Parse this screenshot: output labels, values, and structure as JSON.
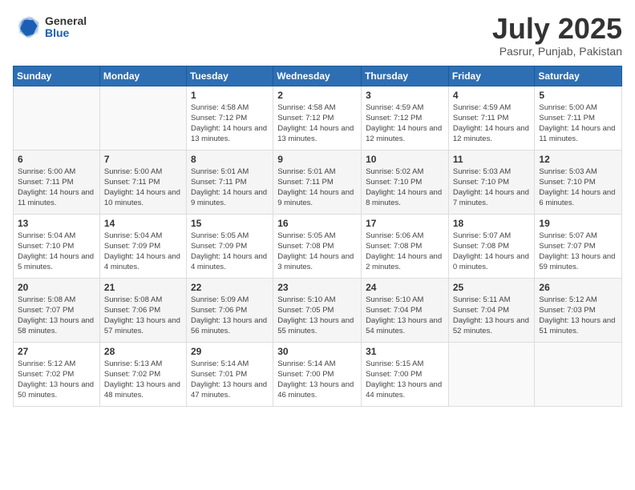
{
  "header": {
    "logo_general": "General",
    "logo_blue": "Blue",
    "month_title": "July 2025",
    "location": "Pasrur, Punjab, Pakistan"
  },
  "weekdays": [
    "Sunday",
    "Monday",
    "Tuesday",
    "Wednesday",
    "Thursday",
    "Friday",
    "Saturday"
  ],
  "weeks": [
    [
      {
        "day": "",
        "sunrise": "",
        "sunset": "",
        "daylight": ""
      },
      {
        "day": "",
        "sunrise": "",
        "sunset": "",
        "daylight": ""
      },
      {
        "day": "1",
        "sunrise": "Sunrise: 4:58 AM",
        "sunset": "Sunset: 7:12 PM",
        "daylight": "Daylight: 14 hours and 13 minutes."
      },
      {
        "day": "2",
        "sunrise": "Sunrise: 4:58 AM",
        "sunset": "Sunset: 7:12 PM",
        "daylight": "Daylight: 14 hours and 13 minutes."
      },
      {
        "day": "3",
        "sunrise": "Sunrise: 4:59 AM",
        "sunset": "Sunset: 7:12 PM",
        "daylight": "Daylight: 14 hours and 12 minutes."
      },
      {
        "day": "4",
        "sunrise": "Sunrise: 4:59 AM",
        "sunset": "Sunset: 7:11 PM",
        "daylight": "Daylight: 14 hours and 12 minutes."
      },
      {
        "day": "5",
        "sunrise": "Sunrise: 5:00 AM",
        "sunset": "Sunset: 7:11 PM",
        "daylight": "Daylight: 14 hours and 11 minutes."
      }
    ],
    [
      {
        "day": "6",
        "sunrise": "Sunrise: 5:00 AM",
        "sunset": "Sunset: 7:11 PM",
        "daylight": "Daylight: 14 hours and 11 minutes."
      },
      {
        "day": "7",
        "sunrise": "Sunrise: 5:00 AM",
        "sunset": "Sunset: 7:11 PM",
        "daylight": "Daylight: 14 hours and 10 minutes."
      },
      {
        "day": "8",
        "sunrise": "Sunrise: 5:01 AM",
        "sunset": "Sunset: 7:11 PM",
        "daylight": "Daylight: 14 hours and 9 minutes."
      },
      {
        "day": "9",
        "sunrise": "Sunrise: 5:01 AM",
        "sunset": "Sunset: 7:11 PM",
        "daylight": "Daylight: 14 hours and 9 minutes."
      },
      {
        "day": "10",
        "sunrise": "Sunrise: 5:02 AM",
        "sunset": "Sunset: 7:10 PM",
        "daylight": "Daylight: 14 hours and 8 minutes."
      },
      {
        "day": "11",
        "sunrise": "Sunrise: 5:03 AM",
        "sunset": "Sunset: 7:10 PM",
        "daylight": "Daylight: 14 hours and 7 minutes."
      },
      {
        "day": "12",
        "sunrise": "Sunrise: 5:03 AM",
        "sunset": "Sunset: 7:10 PM",
        "daylight": "Daylight: 14 hours and 6 minutes."
      }
    ],
    [
      {
        "day": "13",
        "sunrise": "Sunrise: 5:04 AM",
        "sunset": "Sunset: 7:10 PM",
        "daylight": "Daylight: 14 hours and 5 minutes."
      },
      {
        "day": "14",
        "sunrise": "Sunrise: 5:04 AM",
        "sunset": "Sunset: 7:09 PM",
        "daylight": "Daylight: 14 hours and 4 minutes."
      },
      {
        "day": "15",
        "sunrise": "Sunrise: 5:05 AM",
        "sunset": "Sunset: 7:09 PM",
        "daylight": "Daylight: 14 hours and 4 minutes."
      },
      {
        "day": "16",
        "sunrise": "Sunrise: 5:05 AM",
        "sunset": "Sunset: 7:08 PM",
        "daylight": "Daylight: 14 hours and 3 minutes."
      },
      {
        "day": "17",
        "sunrise": "Sunrise: 5:06 AM",
        "sunset": "Sunset: 7:08 PM",
        "daylight": "Daylight: 14 hours and 2 minutes."
      },
      {
        "day": "18",
        "sunrise": "Sunrise: 5:07 AM",
        "sunset": "Sunset: 7:08 PM",
        "daylight": "Daylight: 14 hours and 0 minutes."
      },
      {
        "day": "19",
        "sunrise": "Sunrise: 5:07 AM",
        "sunset": "Sunset: 7:07 PM",
        "daylight": "Daylight: 13 hours and 59 minutes."
      }
    ],
    [
      {
        "day": "20",
        "sunrise": "Sunrise: 5:08 AM",
        "sunset": "Sunset: 7:07 PM",
        "daylight": "Daylight: 13 hours and 58 minutes."
      },
      {
        "day": "21",
        "sunrise": "Sunrise: 5:08 AM",
        "sunset": "Sunset: 7:06 PM",
        "daylight": "Daylight: 13 hours and 57 minutes."
      },
      {
        "day": "22",
        "sunrise": "Sunrise: 5:09 AM",
        "sunset": "Sunset: 7:06 PM",
        "daylight": "Daylight: 13 hours and 56 minutes."
      },
      {
        "day": "23",
        "sunrise": "Sunrise: 5:10 AM",
        "sunset": "Sunset: 7:05 PM",
        "daylight": "Daylight: 13 hours and 55 minutes."
      },
      {
        "day": "24",
        "sunrise": "Sunrise: 5:10 AM",
        "sunset": "Sunset: 7:04 PM",
        "daylight": "Daylight: 13 hours and 54 minutes."
      },
      {
        "day": "25",
        "sunrise": "Sunrise: 5:11 AM",
        "sunset": "Sunset: 7:04 PM",
        "daylight": "Daylight: 13 hours and 52 minutes."
      },
      {
        "day": "26",
        "sunrise": "Sunrise: 5:12 AM",
        "sunset": "Sunset: 7:03 PM",
        "daylight": "Daylight: 13 hours and 51 minutes."
      }
    ],
    [
      {
        "day": "27",
        "sunrise": "Sunrise: 5:12 AM",
        "sunset": "Sunset: 7:02 PM",
        "daylight": "Daylight: 13 hours and 50 minutes."
      },
      {
        "day": "28",
        "sunrise": "Sunrise: 5:13 AM",
        "sunset": "Sunset: 7:02 PM",
        "daylight": "Daylight: 13 hours and 48 minutes."
      },
      {
        "day": "29",
        "sunrise": "Sunrise: 5:14 AM",
        "sunset": "Sunset: 7:01 PM",
        "daylight": "Daylight: 13 hours and 47 minutes."
      },
      {
        "day": "30",
        "sunrise": "Sunrise: 5:14 AM",
        "sunset": "Sunset: 7:00 PM",
        "daylight": "Daylight: 13 hours and 46 minutes."
      },
      {
        "day": "31",
        "sunrise": "Sunrise: 5:15 AM",
        "sunset": "Sunset: 7:00 PM",
        "daylight": "Daylight: 13 hours and 44 minutes."
      },
      {
        "day": "",
        "sunrise": "",
        "sunset": "",
        "daylight": ""
      },
      {
        "day": "",
        "sunrise": "",
        "sunset": "",
        "daylight": ""
      }
    ]
  ]
}
